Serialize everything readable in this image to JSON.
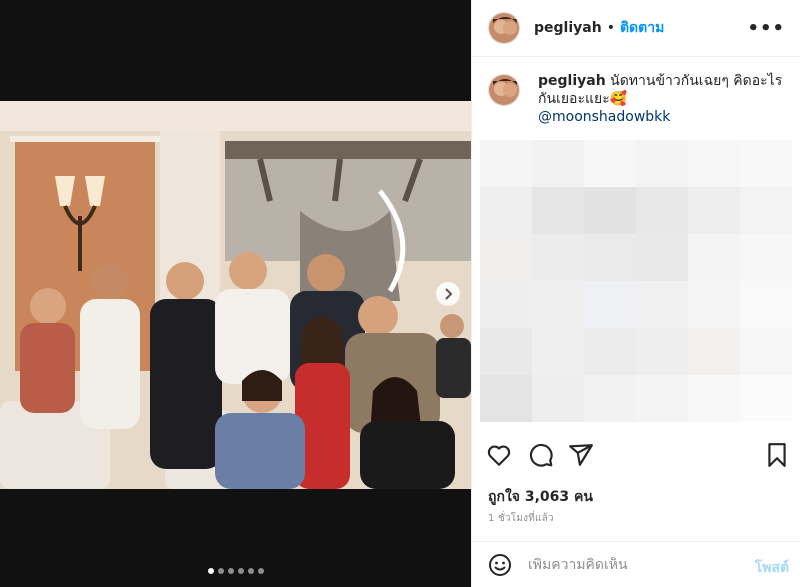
{
  "post": {
    "username": "pegliyah",
    "separator": "•",
    "follow_label": "ติดตาม",
    "more_label": "•••",
    "caption_user": "pegliyah",
    "caption_text": "นัดทานข้าวกันเฉยๆ คิดอะไรกันเยอะแยะ🥰",
    "caption_mention": "@moonshadowbkk",
    "likes_label": "ถูกใจ 3,063 คน",
    "time_label": "1 ชั่วโมงที่แล้ว",
    "carousel": {
      "total": 6,
      "current": 1
    }
  },
  "comment": {
    "placeholder": "เพิ่มความคิดเห็น",
    "post_label": "โพสต์"
  },
  "icons": {
    "like": "heart-icon",
    "comment": "comment-icon",
    "share": "send-icon",
    "save": "bookmark-icon",
    "emoji": "smiley-icon",
    "next": "chevron-right-icon"
  },
  "colors": {
    "accent": "#0095f6",
    "text": "#262626",
    "secondary": "#8e8e8e",
    "mention": "#00376b"
  }
}
